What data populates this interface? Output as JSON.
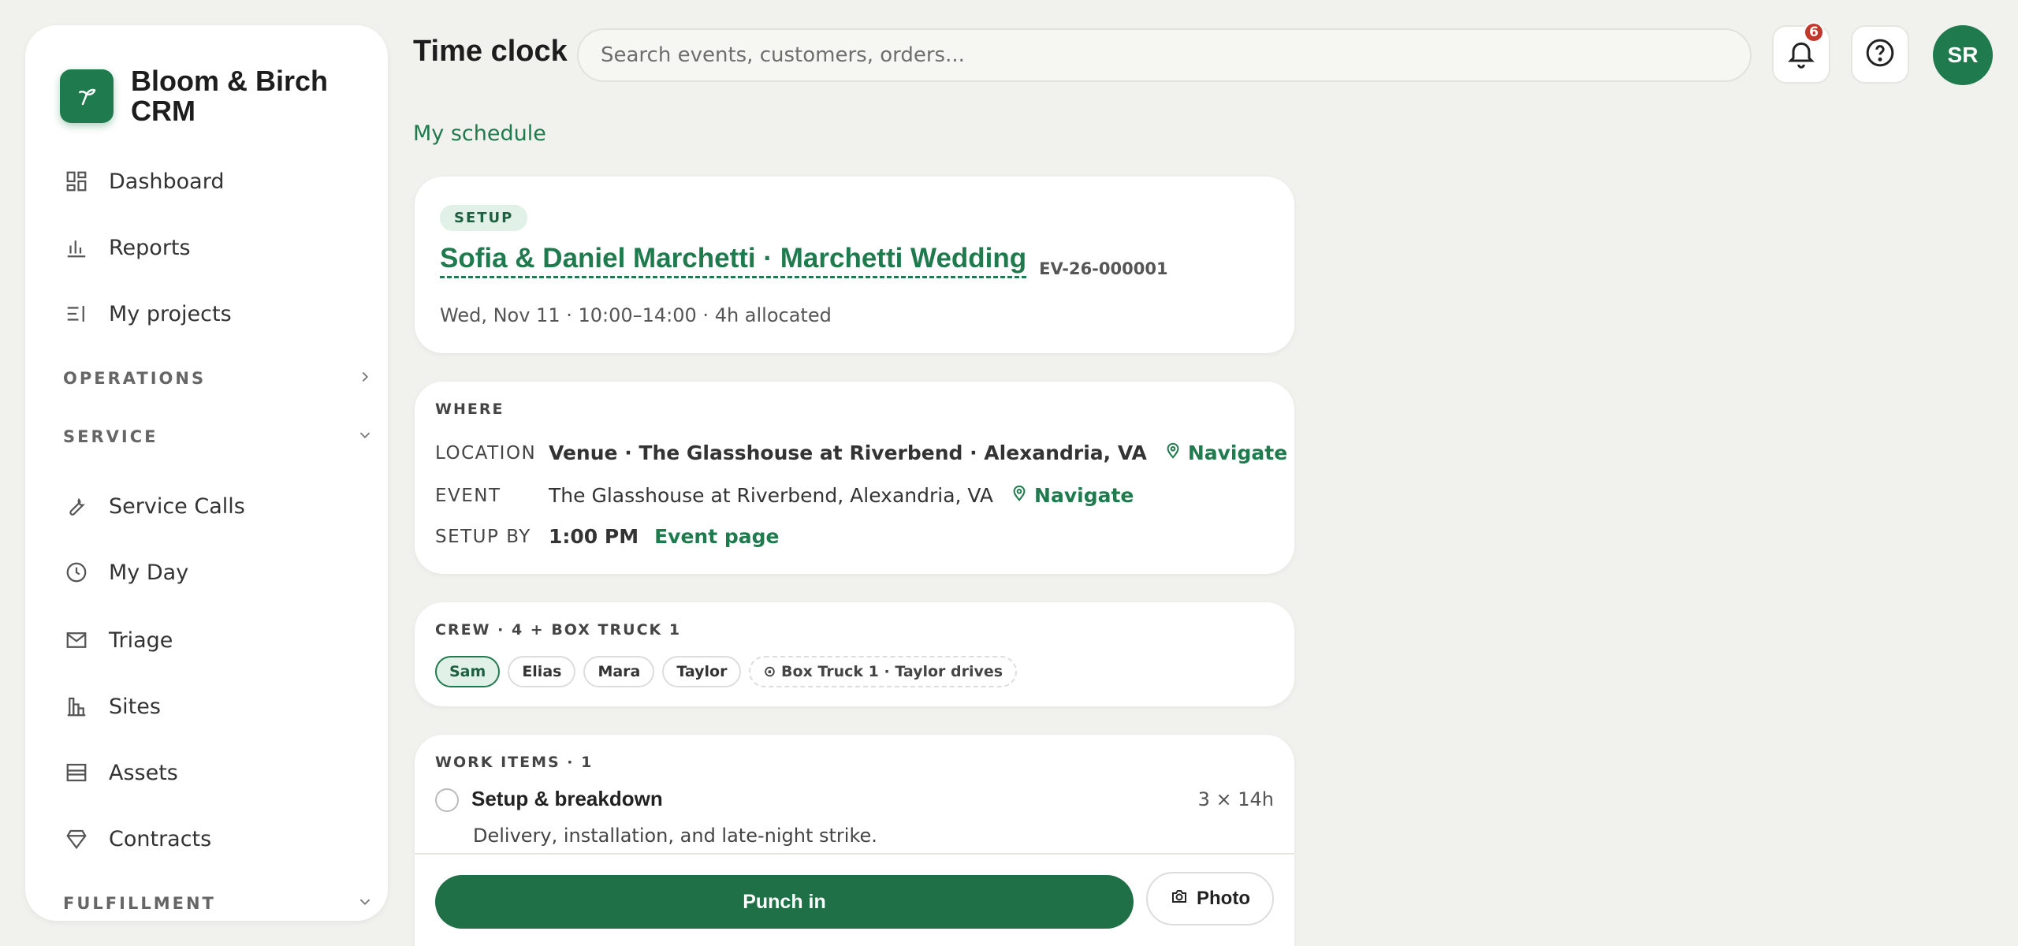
{
  "brand": {
    "name": "Bloom & Birch CRM"
  },
  "sidebar": {
    "top_items": [
      {
        "label": "Dashboard",
        "icon": "dashboard-icon"
      },
      {
        "label": "Reports",
        "icon": "bar-chart-icon"
      },
      {
        "label": "My projects",
        "icon": "list-icon"
      }
    ],
    "sections": [
      {
        "label": "OPERATIONS",
        "state": "collapsed"
      },
      {
        "label": "SERVICE",
        "state": "expanded"
      },
      {
        "label": "FULFILLMENT",
        "state": "expanded"
      }
    ],
    "service_items": [
      {
        "label": "Service Calls",
        "icon": "wrench-icon"
      },
      {
        "label": "My Day",
        "icon": "clock-icon"
      },
      {
        "label": "Triage",
        "icon": "mail-icon"
      },
      {
        "label": "Sites",
        "icon": "building-icon"
      },
      {
        "label": "Assets",
        "icon": "archive-icon"
      },
      {
        "label": "Contracts",
        "icon": "diamond-icon"
      }
    ]
  },
  "header": {
    "title": "Time clock",
    "search_placeholder": "Search events, customers, orders...",
    "notification_count": "6",
    "avatar_initials": "SR"
  },
  "main": {
    "schedule_link": "My schedule",
    "event": {
      "tag": "SETUP",
      "title": "Sofia & Daniel Marchetti · Marchetti Wedding",
      "id": "EV-26-000001",
      "meta": "Wed, Nov 11 · 10:00–14:00 · 4h allocated"
    },
    "where": {
      "caption": "WHERE",
      "location_label": "LOCATION",
      "location_value": "Venue · The Glasshouse at Riverbend · Alexandria, VA",
      "event_label": "EVENT",
      "event_value": "The Glasshouse at Riverbend, Alexandria, VA",
      "navigate_label": "Navigate",
      "setup_label": "SETUP BY",
      "setup_value": "1:00 PM",
      "event_page_label": "Event page"
    },
    "crew": {
      "caption": "CREW · 4 + BOX TRUCK 1",
      "members": [
        "Sam",
        "Elias",
        "Mara",
        "Taylor"
      ],
      "vehicle": "⊙ Box Truck 1 · Taylor drives"
    },
    "work_items": {
      "caption": "WORK ITEMS · 1",
      "items": [
        {
          "title": "Setup & breakdown",
          "qty": "3 × 14h",
          "desc": "Delivery, installation, and late-night strike."
        }
      ]
    },
    "actions": {
      "punch_in": "Punch in",
      "photo": "Photo"
    }
  },
  "colors": {
    "brand": "#1f7a4d",
    "badge": "#c0392b",
    "background": "#f1f1ed"
  }
}
